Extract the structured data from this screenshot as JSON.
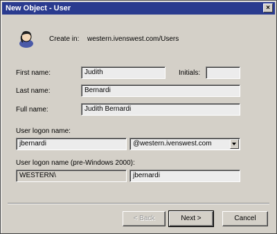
{
  "window": {
    "title": "New Object - User",
    "close_label": "×"
  },
  "create_in": {
    "label": "Create in:",
    "path": "western.ivenswest.com/Users",
    "icon": "user-icon"
  },
  "form": {
    "first_name": {
      "label": "First name:",
      "value": "Judith"
    },
    "initials": {
      "label": "Initials:",
      "value": ""
    },
    "last_name": {
      "label": "Last name:",
      "value": "Bernardi"
    },
    "full_name": {
      "label": "Full name:",
      "value": "Judith Bernardi"
    },
    "logon_name": {
      "label": "User logon name:",
      "value": "jbernardi",
      "domain": "@western.ivenswest.com"
    },
    "pre2000": {
      "label": "User logon name (pre-Windows 2000):",
      "domain": "WESTERN\\",
      "value": "jbernardi"
    }
  },
  "buttons": {
    "back": "< Back",
    "next": "Next >",
    "cancel": "Cancel"
  },
  "colors": {
    "titlebar": "#2a3b8f",
    "face": "#d4d0c8"
  }
}
